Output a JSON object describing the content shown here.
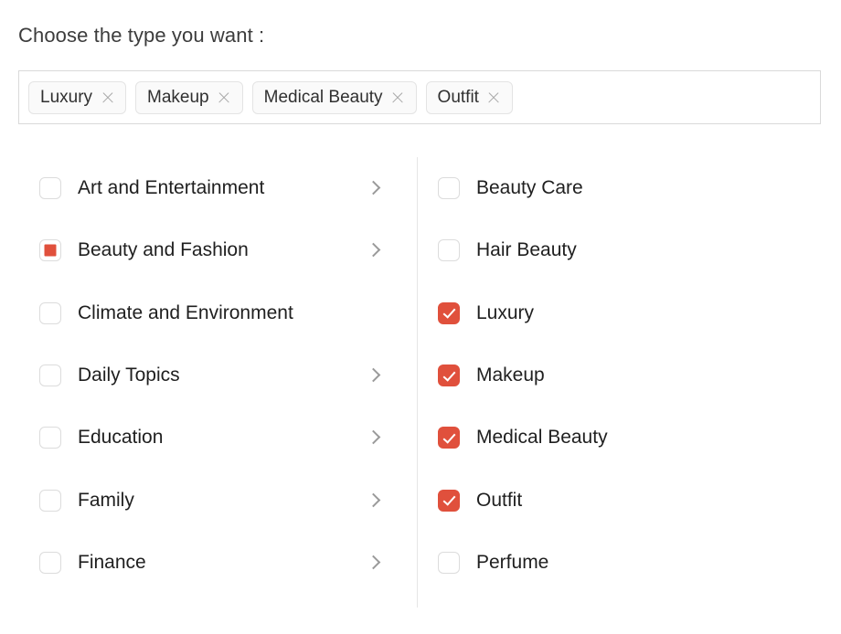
{
  "page": {
    "title": "Choose the type you want :"
  },
  "accent_color": "#e0503c",
  "tag_input": {
    "tags": [
      {
        "label": "Luxury",
        "remove_icon": "close-icon"
      },
      {
        "label": "Makeup",
        "remove_icon": "close-icon"
      },
      {
        "label": "Medical Beauty",
        "remove_icon": "close-icon"
      },
      {
        "label": "Outfit",
        "remove_icon": "close-icon"
      }
    ]
  },
  "picker": {
    "left_column": [
      {
        "label": "Art and Entertainment",
        "state": "unchecked",
        "has_chevron": true
      },
      {
        "label": "Beauty and Fashion",
        "state": "indeterminate",
        "has_chevron": true
      },
      {
        "label": "Climate and Environment",
        "state": "unchecked",
        "has_chevron": false
      },
      {
        "label": "Daily Topics",
        "state": "unchecked",
        "has_chevron": true
      },
      {
        "label": "Education",
        "state": "unchecked",
        "has_chevron": true
      },
      {
        "label": "Family",
        "state": "unchecked",
        "has_chevron": true
      },
      {
        "label": "Finance",
        "state": "unchecked",
        "has_chevron": true
      }
    ],
    "right_column": [
      {
        "label": "Beauty Care",
        "state": "unchecked",
        "has_chevron": false
      },
      {
        "label": "Hair Beauty",
        "state": "unchecked",
        "has_chevron": false
      },
      {
        "label": "Luxury",
        "state": "checked",
        "has_chevron": false
      },
      {
        "label": "Makeup",
        "state": "checked",
        "has_chevron": false
      },
      {
        "label": "Medical Beauty",
        "state": "checked",
        "has_chevron": false
      },
      {
        "label": "Outfit",
        "state": "checked",
        "has_chevron": false
      },
      {
        "label": "Perfume",
        "state": "unchecked",
        "has_chevron": false
      }
    ]
  }
}
